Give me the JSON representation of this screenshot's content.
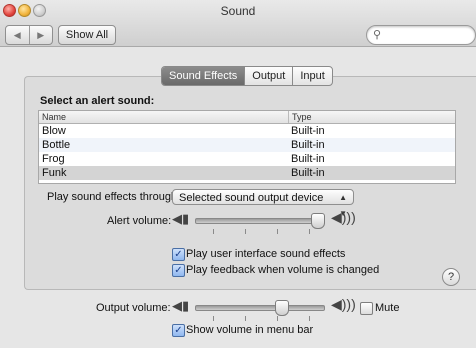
{
  "window": {
    "title": "Sound"
  },
  "toolbar": {
    "back_icon": "back-arrow-icon",
    "forward_icon": "forward-arrow-icon",
    "show_all": "Show All",
    "search_placeholder": ""
  },
  "tabs": [
    {
      "label": "Sound Effects",
      "active": true
    },
    {
      "label": "Output",
      "active": false
    },
    {
      "label": "Input",
      "active": false
    }
  ],
  "alerts": {
    "heading": "Select an alert sound:",
    "columns": [
      "Name",
      "Type"
    ],
    "rows": [
      {
        "name": "Blow",
        "type": "Built-in"
      },
      {
        "name": "Bottle",
        "type": "Built-in"
      },
      {
        "name": "Frog",
        "type": "Built-in"
      },
      {
        "name": "Funk",
        "type": "Built-in",
        "selected": true
      }
    ]
  },
  "effects": {
    "through_label": "Play sound effects through:",
    "through_value": "Selected sound output device",
    "alert_volume_label": "Alert volume:",
    "alert_volume_level": 0.95,
    "ui_sounds_label": "Play user interface sound effects",
    "ui_sounds_checked": true,
    "feedback_label": "Play feedback when volume is changed",
    "feedback_checked": true
  },
  "output": {
    "volume_label": "Output volume:",
    "volume_level": 0.67,
    "mute_label": "Mute",
    "mute_checked": false,
    "menu_bar_label": "Show volume in menu bar",
    "menu_bar_checked": true
  },
  "help": "?",
  "colors": {
    "selection": "#d4d4d4",
    "accent": "#8fb7ef"
  }
}
